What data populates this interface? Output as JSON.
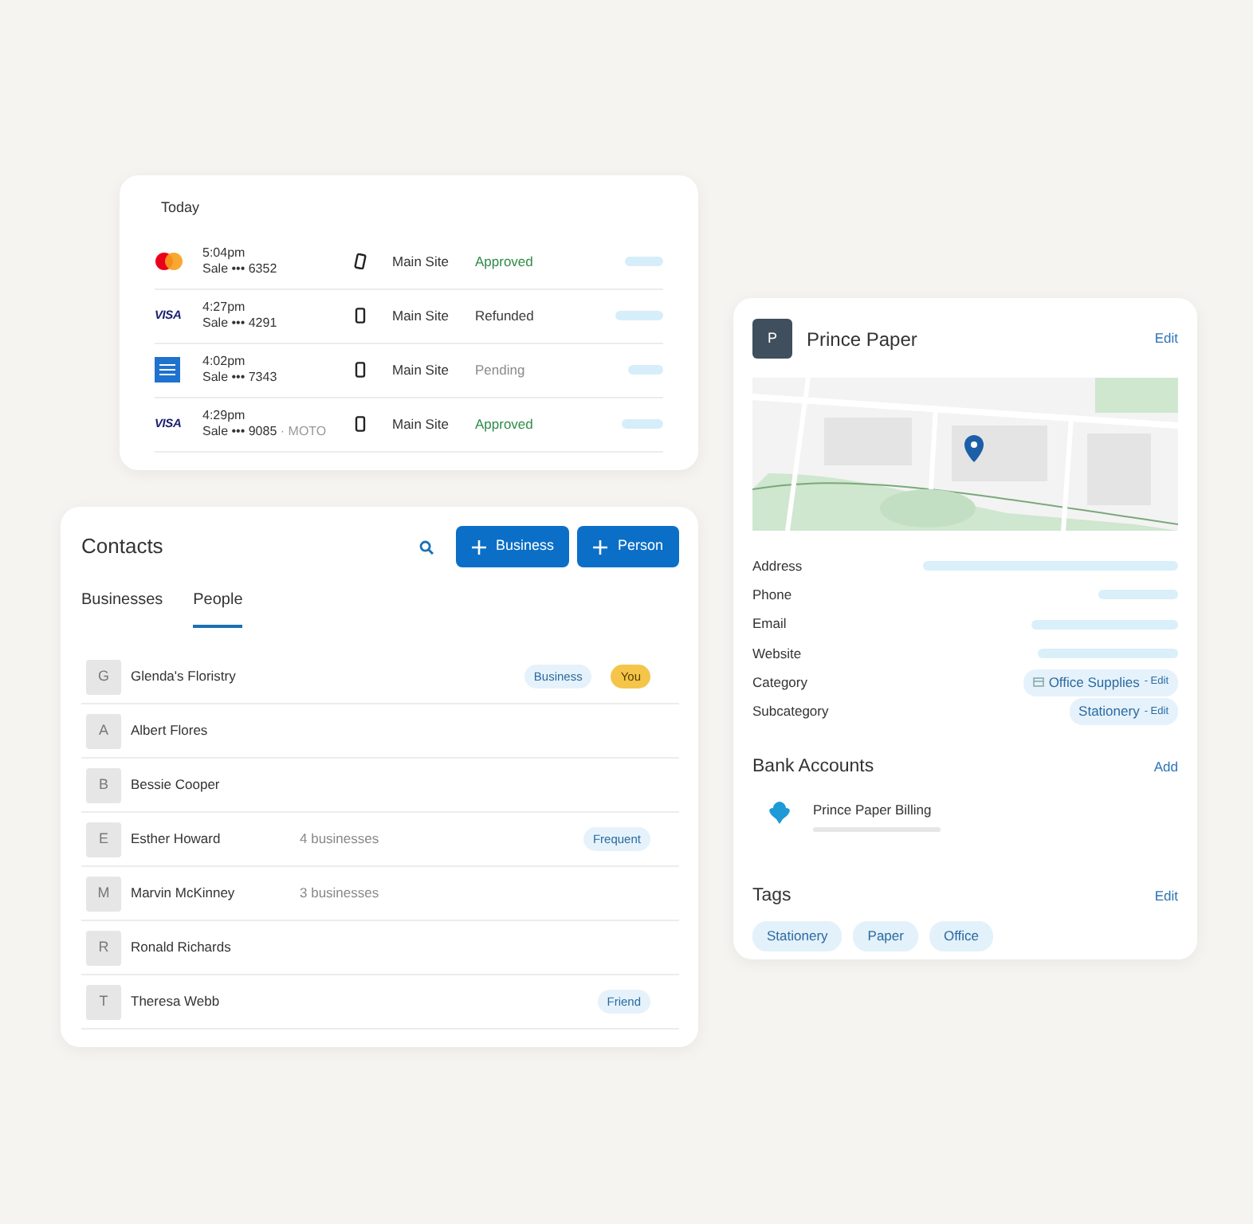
{
  "transactions": {
    "heading": "Today",
    "rows": [
      {
        "card": {
          "kind": "mastercard"
        },
        "time": "5:04pm",
        "detail": "Sale ••• 6352",
        "note": "",
        "device": {
          "kind": "tap"
        },
        "site": "Main Site",
        "status": "Approved",
        "color": "#2e8b47"
      },
      {
        "card": {
          "kind": "visa",
          "label": "VISA"
        },
        "time": "4:27pm",
        "detail": "Sale ••• 4291",
        "note": "",
        "device": {
          "kind": "phone"
        },
        "site": "Main Site",
        "status": "Refunded",
        "color": "#3a3a3a"
      },
      {
        "card": {
          "kind": "amex"
        },
        "time": "4:02pm",
        "detail": "Sale ••• 7343",
        "note": "",
        "device": {
          "kind": "phone"
        },
        "site": "Main Site",
        "status": "Pending",
        "color": "#8a8a8a"
      },
      {
        "card": {
          "kind": "visa",
          "label": "VISA"
        },
        "time": "4:29pm",
        "detail": "Sale ••• 9085",
        "note": "· MOTO",
        "device": {
          "kind": "phone"
        },
        "site": "Main Site",
        "status": "Approved",
        "color": "#2e8b47"
      }
    ]
  },
  "contacts": {
    "title": "Contacts",
    "buttons": [
      "Business",
      "Person"
    ],
    "tabs": [
      {
        "label": "Businesses",
        "selected": false
      },
      {
        "label": "People",
        "selected": true
      }
    ],
    "rows": [
      {
        "initial": "G",
        "name": "Glenda's Floristry",
        "sub": "",
        "badges": [
          {
            "text": "Business",
            "color": "#e6f2fb"
          },
          {
            "text": "You",
            "color": "#f5c54a"
          }
        ]
      },
      {
        "initial": "A",
        "name": "Albert Flores",
        "sub": "",
        "badges": []
      },
      {
        "initial": "B",
        "name": "Bessie Cooper",
        "sub": "",
        "badges": []
      },
      {
        "initial": "E",
        "name": "Esther Howard",
        "sub": "4 businesses",
        "badges": [
          {
            "text": "Frequent",
            "color": "#e6f2fb"
          }
        ]
      },
      {
        "initial": "M",
        "name": "Marvin McKinney",
        "sub": "3 businesses",
        "badges": []
      },
      {
        "initial": "R",
        "name": "Ronald Richards",
        "sub": "",
        "badges": []
      },
      {
        "initial": "T",
        "name": "Theresa Webb",
        "sub": "",
        "badges": [
          {
            "text": "Friend",
            "color": "#e6f2fb"
          }
        ]
      }
    ]
  },
  "business": {
    "initial": "P",
    "name": "Prince Paper",
    "edit": "Edit",
    "details": [
      {
        "label": "Address",
        "kind": "bar"
      },
      {
        "label": "Phone",
        "kind": "bar"
      },
      {
        "label": "Email",
        "kind": "bar"
      },
      {
        "label": "Website",
        "kind": "bar"
      },
      {
        "label": "Category",
        "kind": "pill",
        "value": "Office Supplies",
        "action": "- Edit",
        "icon": true
      },
      {
        "label": "Subcategory",
        "kind": "pill",
        "value": "Stationery",
        "action": "- Edit",
        "icon": false
      }
    ],
    "bank": {
      "title": "Bank Accounts",
      "action": "Add",
      "accounts": [
        {
          "name": "Prince Paper Billing"
        }
      ]
    },
    "tags": {
      "title": "Tags",
      "action": "Edit",
      "items": [
        "Stationery",
        "Paper",
        "Office"
      ]
    }
  }
}
